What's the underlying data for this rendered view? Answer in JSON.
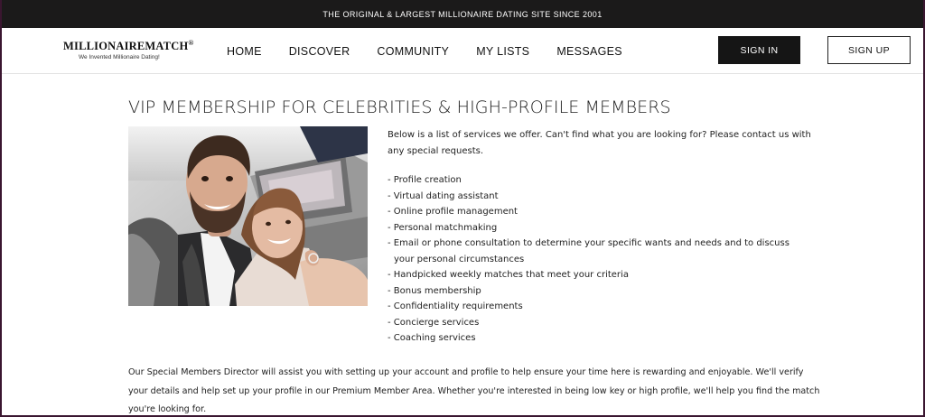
{
  "topbar": {
    "text": "THE ORIGINAL & LARGEST MILLIONAIRE DATING SITE SINCE 2001"
  },
  "logo": {
    "name": "MILLIONAIREMATCH",
    "mark": "®",
    "tagline": "We Invented Millionaire Dating!"
  },
  "nav": {
    "items": [
      "HOME",
      "DISCOVER",
      "COMMUNITY",
      "MY LISTS",
      "MESSAGES"
    ]
  },
  "auth": {
    "signin": "SIGN IN",
    "signup": "SIGN UP"
  },
  "page": {
    "title": "VIP MEMBERSHIP FOR CELEBRITIES & HIGH-PROFILE MEMBERS"
  },
  "services": {
    "intro": "Below is a list of services we offer. Can't find what you are looking for? Please contact us with any special requests.",
    "items": [
      "- Profile creation",
      "- Virtual dating assistant",
      "- Online profile management",
      "- Personal matchmaking",
      "- Email or phone consultation to determine your specific wants and needs and to discuss your personal circumstances",
      "- Handpicked weekly matches that meet your criteria",
      "- Bonus membership",
      "- Confidentiality requirements",
      "- Concierge services",
      "- Coaching services"
    ]
  },
  "footer": {
    "text": "Our Special Members Director will assist you with setting up your account and profile to help ensure your time here is rewarding and enjoyable. We'll verify your details and help set up your profile in our Premium Member Area. Whether you're interested in being low key or high profile, we'll help you find the match you're looking for."
  },
  "colors": {
    "topbar_bg": "#1b1a1a",
    "signin_bg": "#151515",
    "frame": "#3a1630"
  }
}
